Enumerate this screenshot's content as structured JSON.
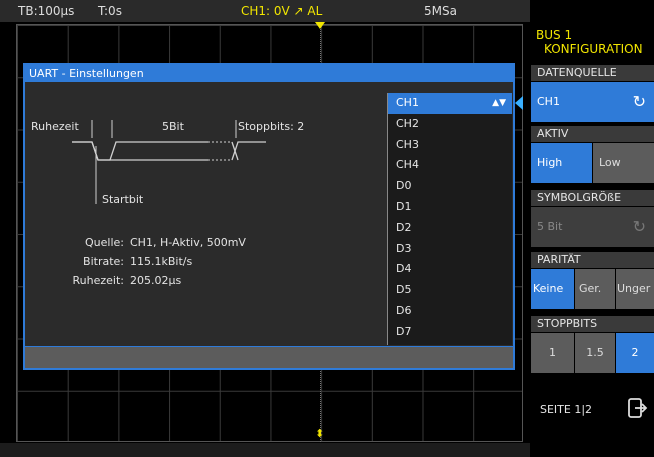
{
  "topbar": {
    "timebase": "TB:100µs",
    "trigger_time": "T:0s",
    "channel": "CH1: 0V ↗ AL",
    "samplerate": "5MSa"
  },
  "dialog": {
    "title": "UART - Einstellungen",
    "diagram": {
      "idle_label": "Ruhezeit",
      "bits_label": "5Bit",
      "stop_label": "Stoppbits: 2",
      "start_label": "Startbit"
    },
    "info": {
      "quelle_label": "Quelle:",
      "quelle_value": "CH1, H-Aktiv, 500mV",
      "bitrate_label": "Bitrate:",
      "bitrate_value": "115.1kBit/s",
      "ruhezeit_label": "Ruhezeit:",
      "ruhezeit_value": "205.02µs"
    },
    "channels": [
      "CH1",
      "CH2",
      "CH3",
      "CH4",
      "D0",
      "D1",
      "D2",
      "D3",
      "D4",
      "D5",
      "D6",
      "D7"
    ],
    "selected_channel": "CH1",
    "selector_arrows": "▲▼"
  },
  "panel": {
    "bus_title": "BUS 1",
    "bus_subtitle": "KONFIGURATION",
    "datenquelle": {
      "header": "DATENQUELLE",
      "value": "CH1"
    },
    "aktiv": {
      "header": "AKTIV",
      "high": "High",
      "low": "Low"
    },
    "symbolgroesse": {
      "header": "SYMBOLGRÖßE",
      "value": "5 Bit"
    },
    "paritaet": {
      "header": "PARITÄT",
      "keine": "Keine",
      "ger": "Ger.",
      "unger": "Unger"
    },
    "stoppbits": {
      "header": "STOPPBITS",
      "one": "1",
      "one_five": "1.5",
      "two": "2"
    },
    "page": "SEITE 1|2"
  },
  "colors": {
    "accent_blue": "#2f7bd8",
    "trigger_yellow": "#f2e600"
  }
}
